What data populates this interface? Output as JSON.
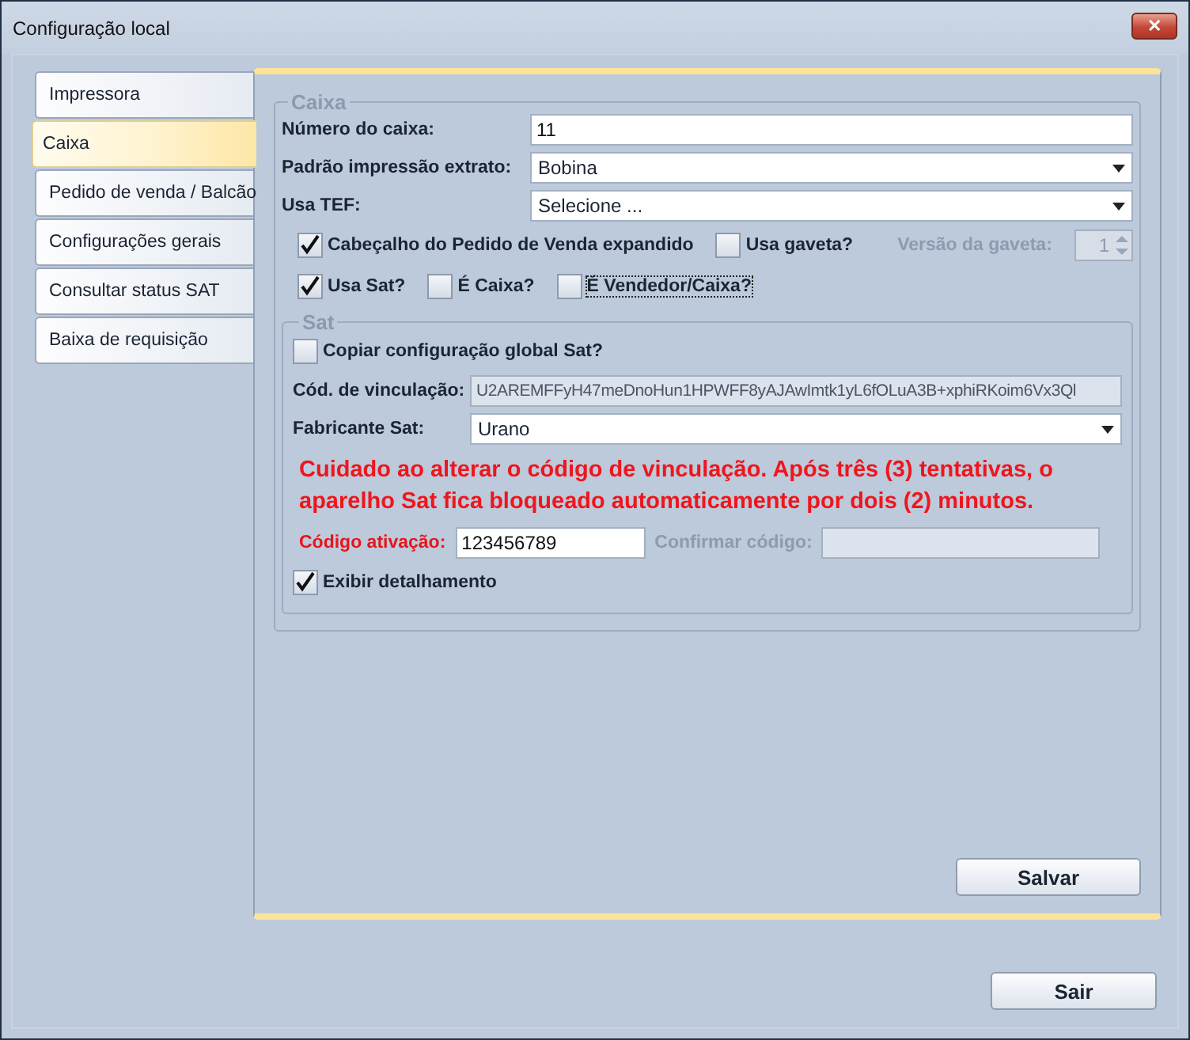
{
  "window": {
    "title": "Configuração local",
    "close_label": "✕"
  },
  "tabs": [
    {
      "label": "Impressora",
      "selected": false
    },
    {
      "label": "Caixa",
      "selected": true
    },
    {
      "label": "Pedido de venda / Balcão",
      "selected": false
    },
    {
      "label": "Configurações gerais",
      "selected": false
    },
    {
      "label": "Consultar status SAT",
      "selected": false
    },
    {
      "label": "Baixa de requisição",
      "selected": false
    }
  ],
  "caixa": {
    "title": "Caixa",
    "fields": [
      {
        "kind": "text",
        "label": "Número do caixa:",
        "value": "11"
      },
      {
        "kind": "dropdown",
        "label": "Padrão impressão extrato:",
        "value": "Bobina"
      },
      {
        "kind": "dropdown",
        "label": "Usa TEF:",
        "value": "Selecione ..."
      }
    ],
    "options_row_1": [
      {
        "label": "Cabeçalho do Pedido de Venda expandido",
        "checked": true,
        "focused": false
      },
      {
        "label": "Usa gaveta?",
        "checked": false,
        "focused": false
      }
    ],
    "gaveta_version": {
      "label": "Versão da gaveta:",
      "value": "1",
      "disabled": true
    },
    "options_row_2": [
      {
        "label": "Usa Sat?",
        "checked": true,
        "focused": false
      },
      {
        "label": "É Caixa?",
        "checked": false,
        "focused": false
      },
      {
        "label": "É Vendedor/Caixa?",
        "checked": false,
        "focused": true
      }
    ]
  },
  "sat": {
    "title": "Sat",
    "copy_global": {
      "label": "Copiar configuração global Sat?",
      "checked": false
    },
    "fields": [
      {
        "kind": "readonly",
        "label": "Cód. de vinculação:",
        "value": "U2AREMFFyH47meDnoHun1HPWFF8yAJAwImtk1yL6fOLuA3B+xphiRKoim6Vx3Ql"
      },
      {
        "kind": "dropdown",
        "label": "Fabricante Sat:",
        "value": "Urano"
      }
    ],
    "warning": "Cuidado ao alterar o código de vinculação. Após três (3) tentativas, o aparelho Sat fica bloqueado automaticamente por dois (2) minutos.",
    "activation": {
      "label": "Código ativação:",
      "value": "123456789"
    },
    "confirm": {
      "label": "Confirmar código:",
      "disabled": true
    },
    "details": {
      "label": "Exibir detalhamento",
      "checked": true
    }
  },
  "buttons": {
    "save": "Salvar",
    "exit": "Sair"
  }
}
